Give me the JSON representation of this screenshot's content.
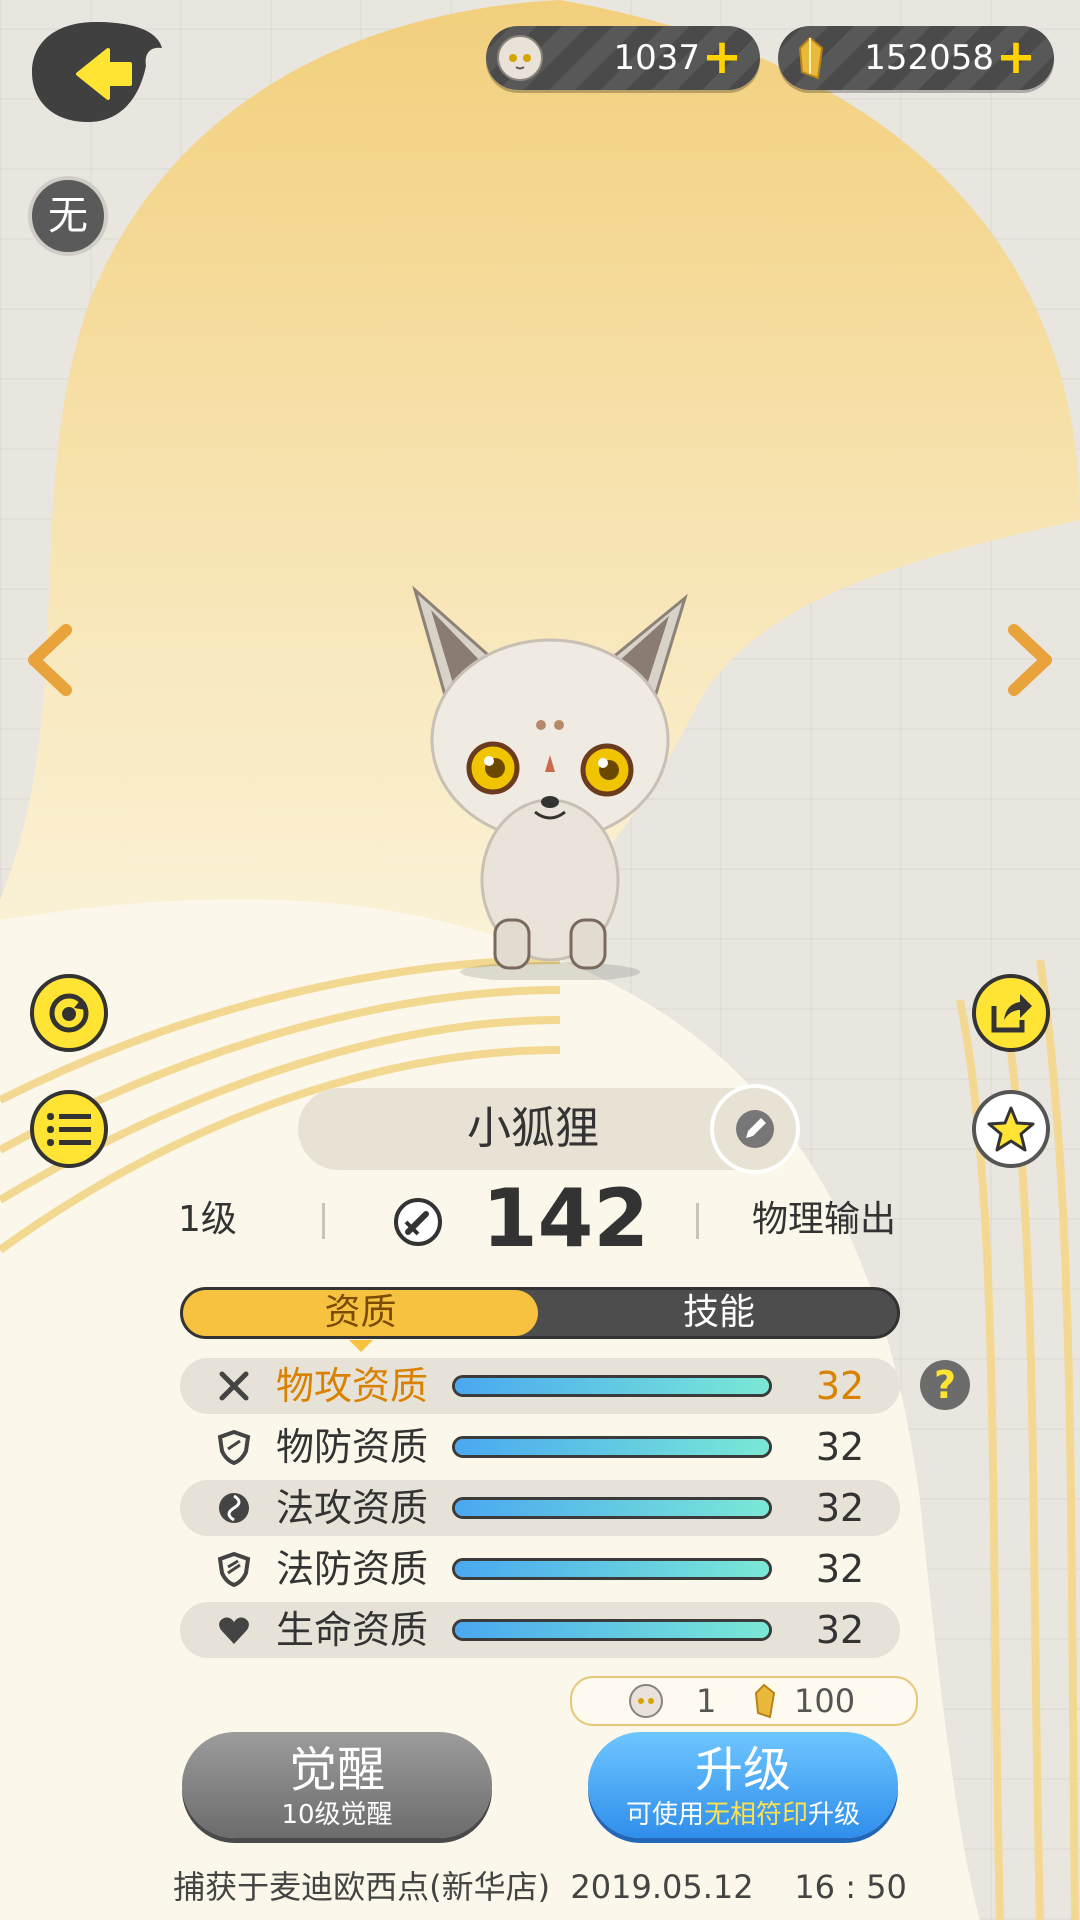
{
  "currency": {
    "pet_count": "1037",
    "crystal_count": "152058",
    "pet_icon": "fox-face-icon",
    "crystal_icon": "gold-crystal-icon"
  },
  "status_badge": "无",
  "pet": {
    "name": "小狐狸",
    "level": "1级",
    "power": "142",
    "role": "物理输出"
  },
  "tabs": [
    "资质",
    "技能"
  ],
  "attributes": [
    {
      "label": "物攻资质",
      "value": "32",
      "icon": "crossed-swords-icon",
      "fill": 1.0
    },
    {
      "label": "物防资质",
      "value": "32",
      "icon": "shield-icon",
      "fill": 1.0
    },
    {
      "label": "法攻资质",
      "value": "32",
      "icon": "magic-swirl-icon",
      "fill": 1.0
    },
    {
      "label": "法防资质",
      "value": "32",
      "icon": "magic-shield-icon",
      "fill": 1.0
    },
    {
      "label": "生命资质",
      "value": "32",
      "icon": "heart-icon",
      "fill": 1.0
    }
  ],
  "cost": {
    "pet_cost": "1",
    "crystal_cost": "100"
  },
  "buttons": {
    "awaken_label": "觉醒",
    "awaken_sub": "10级觉醒",
    "upgrade_label": "升级",
    "upgrade_sub_pre": "可使用",
    "upgrade_sub_hl": "无相符印",
    "upgrade_sub_post": "升级"
  },
  "footer": "捕获于麦迪欧西点(新华店)  2019.05.12    16 : 50",
  "colors": {
    "accent": "#f6c23f",
    "highlight": "#d98100",
    "upgrade": "#2f8eeb"
  }
}
